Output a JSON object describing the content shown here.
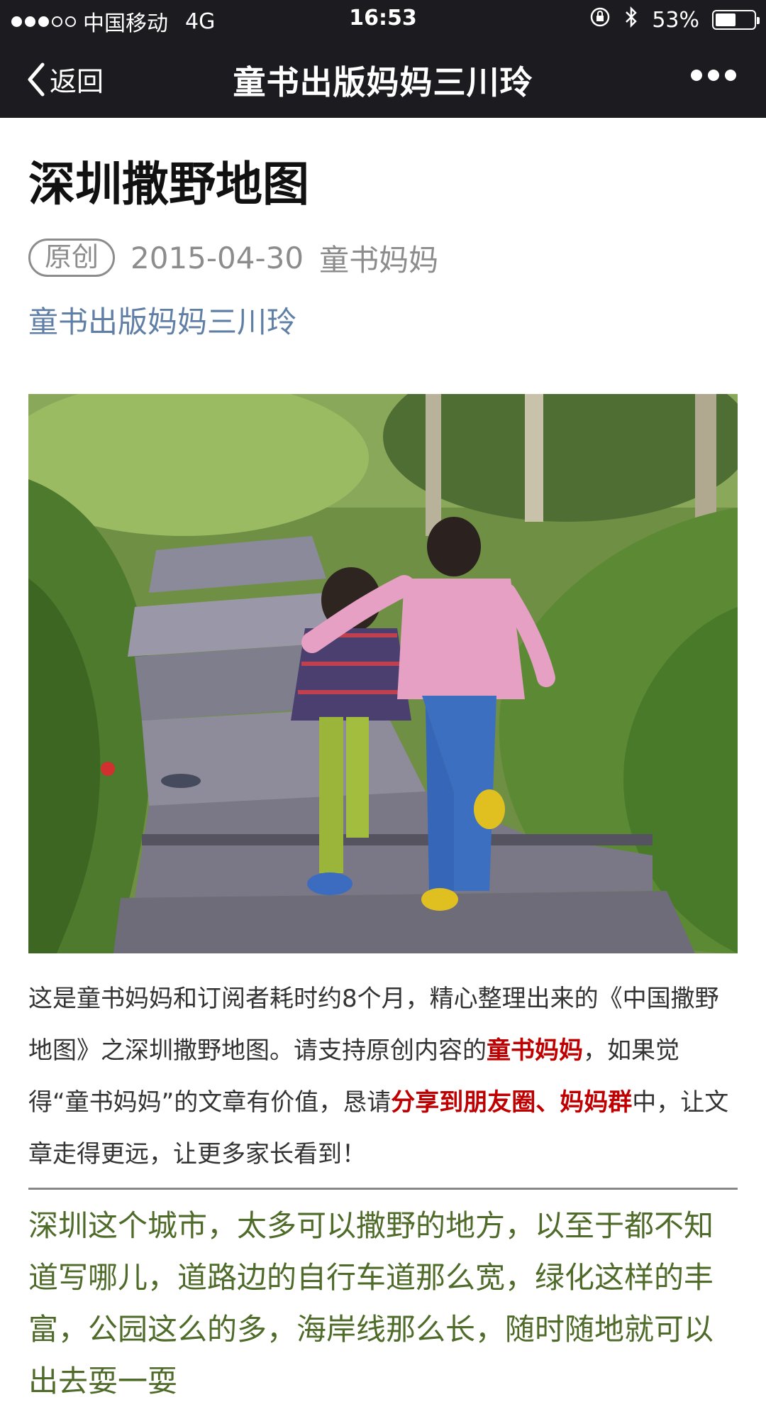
{
  "status_bar": {
    "carrier": "中国移动",
    "network": "4G",
    "time": "16:53",
    "battery_text": "53%",
    "battery_level": 0.53,
    "signal_strength": 3,
    "signal_max": 5
  },
  "nav": {
    "back_label": "返回",
    "title": "童书出版妈妈三川玲"
  },
  "article": {
    "title": "深圳撒野地图",
    "badge": "原创",
    "date": "2015-04-30",
    "author": "童书妈妈",
    "account_link": "童书出版妈妈三川玲",
    "intro": {
      "p1": "这是童书妈妈和订阅者耗时约8个月，精心整理出来的《中国撒野地图》之深圳撒野地图。请支持原创内容的",
      "hl1": "童书妈妈",
      "p2": "，如果觉得“童书妈妈”的文章有价值，恳请",
      "hl2": "分享到朋友圈、妈妈群",
      "p3": "中，让文章走得更远，让更多家长看到！"
    },
    "body": "深圳这个城市，太多可以撒野的地方，以至于都不知道写哪儿，道路边的自行车道那么宽，绿化这样的丰富，公园这么的多，海岸线那么长，随时随地就可以出去耍一耍"
  },
  "colors": {
    "bar": "#1c1c20",
    "link": "#607fa6",
    "highlight": "#c00000",
    "green_text": "#4f6b2a"
  }
}
